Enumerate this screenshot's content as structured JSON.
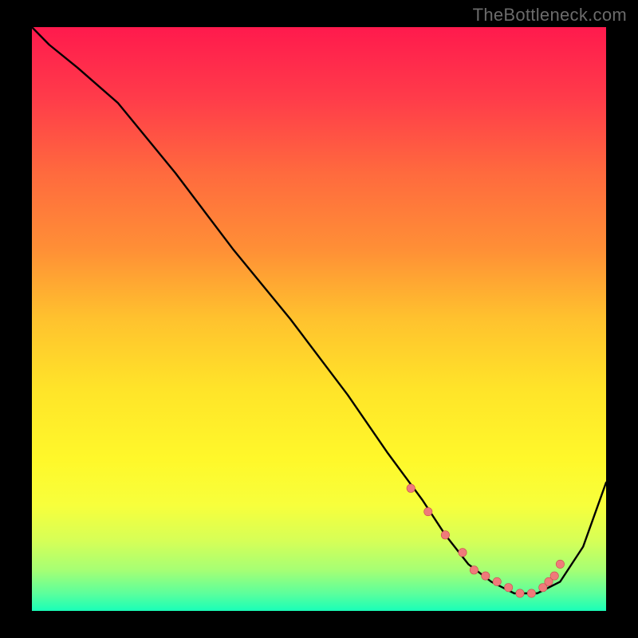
{
  "watermark": "TheBottleneck.com",
  "colors": {
    "gradient_stops": [
      {
        "offset": 0.0,
        "color": "#ff1a4d"
      },
      {
        "offset": 0.12,
        "color": "#ff3b4a"
      },
      {
        "offset": 0.25,
        "color": "#ff6a3e"
      },
      {
        "offset": 0.38,
        "color": "#ff8f36"
      },
      {
        "offset": 0.5,
        "color": "#ffc22e"
      },
      {
        "offset": 0.62,
        "color": "#ffe429"
      },
      {
        "offset": 0.74,
        "color": "#fff82a"
      },
      {
        "offset": 0.82,
        "color": "#f7ff3c"
      },
      {
        "offset": 0.88,
        "color": "#d6ff57"
      },
      {
        "offset": 0.93,
        "color": "#a6ff74"
      },
      {
        "offset": 0.97,
        "color": "#5cff9c"
      },
      {
        "offset": 1.0,
        "color": "#19ffb8"
      }
    ],
    "line": "#000000",
    "marker_fill": "#ef7a7a",
    "marker_stroke": "#c94f4f"
  },
  "chart_data": {
    "type": "line",
    "title": "",
    "xlabel": "",
    "ylabel": "",
    "xlim": [
      0,
      100
    ],
    "ylim": [
      0,
      100
    ],
    "series": [
      {
        "name": "curve",
        "x": [
          0,
          3,
          8,
          15,
          25,
          35,
          45,
          55,
          62,
          68,
          72,
          76,
          80,
          84,
          88,
          92,
          96,
          100
        ],
        "y": [
          100,
          97,
          93,
          87,
          75,
          62,
          50,
          37,
          27,
          19,
          13,
          8,
          5,
          3,
          3,
          5,
          11,
          22
        ]
      }
    ],
    "markers": {
      "x": [
        66,
        69,
        72,
        75,
        77,
        79,
        81,
        83,
        85,
        87,
        89,
        90,
        91,
        92
      ],
      "y": [
        21,
        17,
        13,
        10,
        7,
        6,
        5,
        4,
        3,
        3,
        4,
        5,
        6,
        8
      ]
    }
  }
}
